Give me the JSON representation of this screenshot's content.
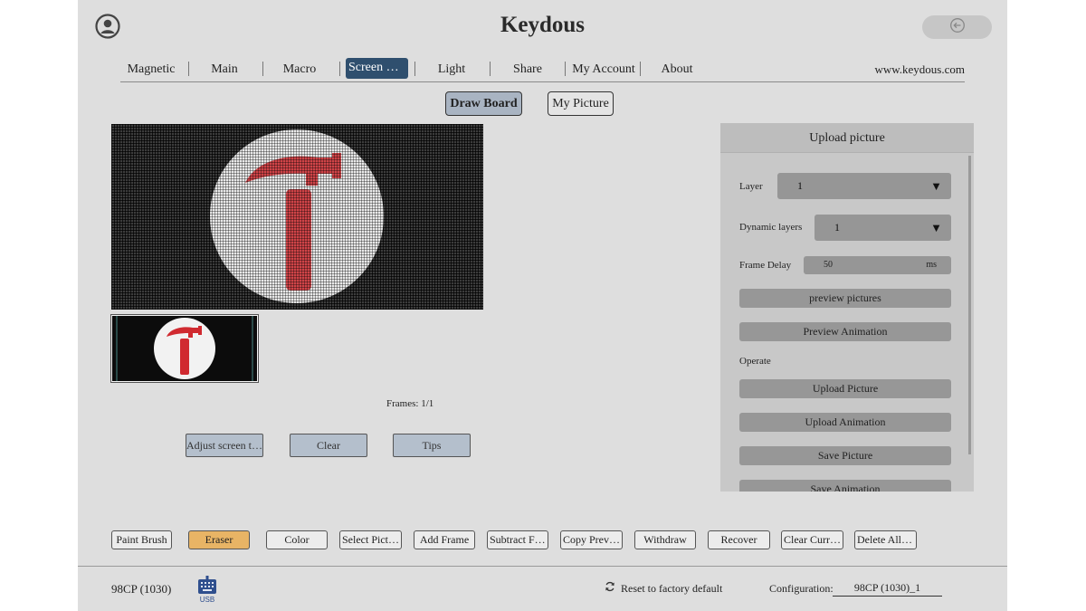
{
  "app": {
    "title": "Keydous",
    "avatar_icon": "user-circle-icon",
    "back_icon": "back-arrow-icon"
  },
  "nav": {
    "items": [
      "Magnetic",
      "Main",
      "Macro",
      "Screen Se…",
      "Light",
      "Share",
      "My Account",
      "About"
    ],
    "active_index": 3,
    "website": "www.keydous.com"
  },
  "subtabs": {
    "draw_board": "Draw Board",
    "my_picture": "My Picture",
    "active": "Draw Board"
  },
  "canvas": {
    "frames_label": "Frames: 1/1",
    "background_color": "#3c3c3c",
    "circle_color": "#e9e9e9",
    "hammer_color": "#d04448"
  },
  "canvas_buttons": {
    "adjust": "Adjust screen t…",
    "clear": "Clear",
    "tips": "Tips"
  },
  "panel": {
    "title": "Upload picture",
    "layer_label": "Layer",
    "layer_value": "1",
    "dynamic_label": "Dynamic layers",
    "dynamic_value": "1",
    "delay_label": "Frame Delay",
    "delay_value": "50",
    "delay_unit": "ms",
    "preview_pictures": "preview pictures",
    "preview_animation": "Preview Animation",
    "operate_label": "Operate",
    "upload_picture": "Upload Picture",
    "upload_animation": "Upload Animation",
    "save_picture": "Save Picture",
    "save_animation": "Save Animation"
  },
  "toolbar": {
    "items": [
      "Paint Brush",
      "Eraser",
      "Color",
      "Select Picture",
      "Add Frame",
      "Subtract Fr…",
      "Copy Previ…",
      "Withdraw",
      "Recover",
      "Clear Curr…",
      "Delete All …"
    ],
    "active_index": 1,
    "active_color": "#e8b465"
  },
  "footer": {
    "device": "98CP (1030)",
    "usb_label": "USB",
    "reset_label": "Reset to factory default",
    "config_label": "Configuration:",
    "config_value": "98CP (1030)_1"
  }
}
